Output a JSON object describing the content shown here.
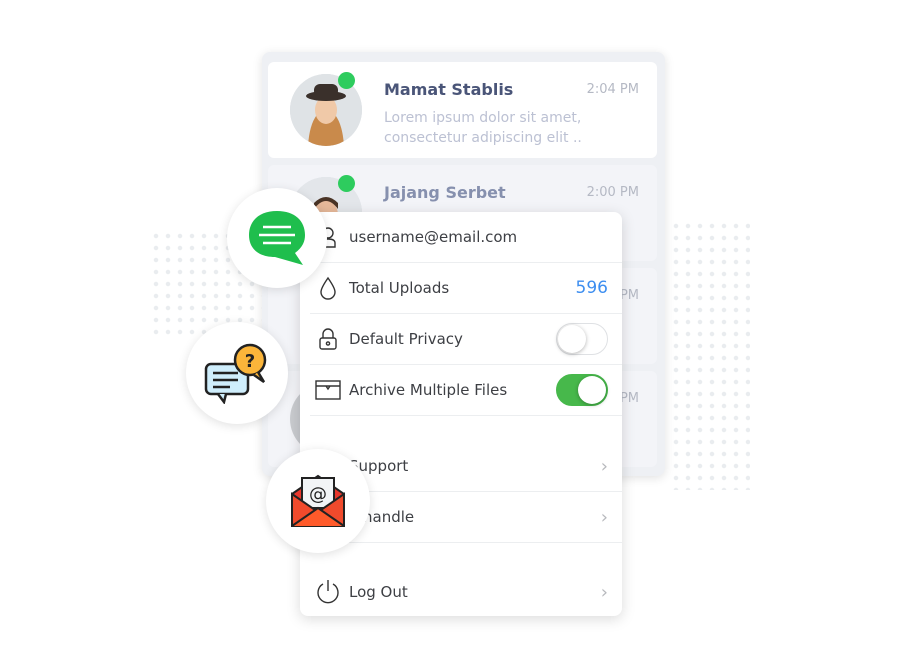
{
  "chats": [
    {
      "name": "Mamat Stablis",
      "time": "2:04 PM",
      "message": "Lorem ipsum dolor sit amet, consectetur adipiscing elit ..",
      "online": true
    },
    {
      "name": "Jajang Serbet",
      "time": "2:00 PM",
      "online": true
    },
    {
      "time": "PM"
    },
    {
      "time": "PM"
    }
  ],
  "menu": {
    "email": "username@email.com",
    "uploads_label": "Total Uploads",
    "uploads_value": "596",
    "privacy_label": "Default Privacy",
    "privacy_on": false,
    "archive_label": "Archive Multiple Files",
    "archive_on": true,
    "support_label": "Support",
    "handle_label": "handle",
    "logout_label": "Log Out"
  },
  "colors": {
    "accent": "#3d8ef0",
    "toggle_on": "#47b84b",
    "online": "#2ecc5e"
  }
}
